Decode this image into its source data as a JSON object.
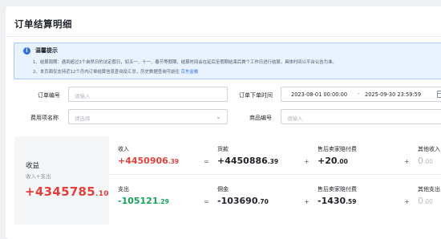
{
  "page": {
    "title": "订单结算明细"
  },
  "notice": {
    "title": "温馨提示",
    "icon": "info-icon",
    "line1": "1、结算周期：遇到超过3个自然日的法定假日，如五一、十一、春节等假期，结算时间会在延后至假期结束后首个工作日进行结算，具体时间以平台公告为准。",
    "line2_prefix": "2、本页面仅支持近12个月内订单结算信息查询及汇总，历史数据查询可前往",
    "line2_link": "京东金融"
  },
  "filters": {
    "order_no_label": "订单编号",
    "order_no_placeholder": "请输入",
    "order_time_label": "订单下单时间",
    "order_time_start": "2023-08-01 00:00:00",
    "order_time_sep": "-",
    "order_time_end": "2025-09-30 23:59:59",
    "fee_item_label": "费用项名称",
    "fee_item_placeholder": "请选择",
    "product_no_label": "商品编号",
    "product_no_placeholder": "请输入"
  },
  "summary": {
    "label": "收益",
    "sub": "收入+支出",
    "total_int": "+4345785",
    "total_dec": ".10",
    "income": {
      "label": "收入",
      "value_int": "+4450906",
      "value_dec": ".39",
      "eq": "=",
      "goods_label": "货款",
      "goods_int": "+4450886",
      "goods_dec": ".39",
      "plus1": "+",
      "after_sale_label": "售后卖家赔付费",
      "after_sale_int": "+20",
      "after_sale_dec": ".00",
      "plus2": "+",
      "other_label": "其他收入",
      "other_int": "0",
      "other_dec": ".00"
    },
    "expense": {
      "label": "支出",
      "value_int": "-105121",
      "value_dec": ".29",
      "eq": "=",
      "commission_label": "佣金",
      "commission_int": "-103690",
      "commission_dec": ".70",
      "plus1": "+",
      "after_sale_label": "售后卖家赔付费",
      "after_sale_int": "-1430",
      "after_sale_dec": ".59",
      "plus2": "+",
      "other_label": "其他支出",
      "other_int": "0",
      "other_dec": ".00"
    }
  },
  "colors": {
    "positive": "#e0413c",
    "negative": "#17a35a",
    "accent": "#2f6fe4"
  }
}
